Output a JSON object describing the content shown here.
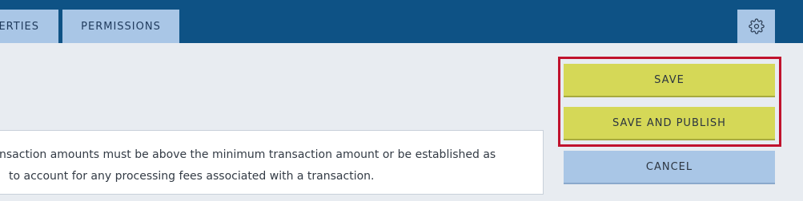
{
  "tabs": {
    "properties_label": "ERTIES",
    "permissions_label": "PERMISSIONS"
  },
  "icons": {
    "settings": "gear-icon"
  },
  "actions": {
    "save_label": "SAVE",
    "save_publish_label": "SAVE AND PUBLISH",
    "cancel_label": "CANCEL"
  },
  "info": {
    "line1": "nsaction amounts must be above the minimum transaction amount or be established as",
    "line2": "to account for any processing fees associated with a transaction."
  },
  "colors": {
    "header_bg": "#0e5285",
    "tab_bg": "#a9c6e6",
    "primary_btn": "#d5d857",
    "highlight_border": "#c0122d",
    "page_bg": "#e8ecf1"
  }
}
